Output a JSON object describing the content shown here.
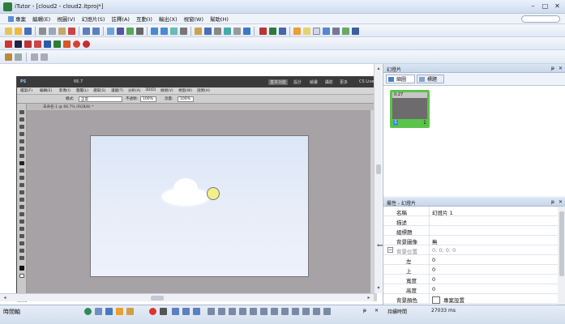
{
  "window": {
    "title": "iTutor - [cloud2 - cloud2.itproj*]",
    "controls": [
      "–",
      "□",
      "✕"
    ]
  },
  "menu": [
    "專案",
    "編輯(E)",
    "視圖(V)",
    "幻燈片(S)",
    "註釋(A)",
    "互動(I)",
    "輸出(X)",
    "視窗(W)",
    "幫助(H)"
  ],
  "photoshop": {
    "top_label": "PS",
    "zoom": "66.7",
    "workspace_buttons": [
      "基本功能",
      "設計",
      "繪畫",
      "攝影",
      "更多"
    ],
    "cs_live": "CS Live",
    "menu": [
      "檔案(F)",
      "編輯(E)",
      "影像(I)",
      "圖層(L)",
      "選取(S)",
      "濾鏡(T)",
      "分析(A)",
      "3D(D)",
      "檢視(V)",
      "視窗(W)",
      "說明(H)"
    ],
    "options": {
      "mode_label": "模式:",
      "mode_value": "正常",
      "opacity_label": "不透明:",
      "opacity_value": "100%",
      "flow_label": "流量:",
      "flow_value": "100%"
    },
    "doc_tab": "未命名-1 @ 66.7% (RGB/8) *"
  },
  "right_panel": {
    "slides_title": "幻燈片",
    "tabs": [
      "縮圖",
      "標題"
    ],
    "slide": {
      "time": "0:27",
      "index_badge": "1",
      "number": "1"
    },
    "props_title": "屬性 - 幻燈片",
    "properties": [
      {
        "key": "名稱",
        "value": "幻燈片 1"
      },
      {
        "key": "描述",
        "value": ""
      },
      {
        "key": "組標題",
        "value": ""
      },
      {
        "key": "背景圖像",
        "value": "無"
      },
      {
        "key": "背景位置",
        "value": "0; 0; 0; 0"
      },
      {
        "key": "左",
        "value": "0"
      },
      {
        "key": "上",
        "value": "0"
      },
      {
        "key": "寬度",
        "value": "0"
      },
      {
        "key": "高度",
        "value": "0"
      },
      {
        "key": "背景顏色",
        "value": "專案設置"
      },
      {
        "key": "持續時間",
        "value": "27033 ms"
      }
    ],
    "pin": "ᵽ",
    "close": "✕"
  },
  "timeline": {
    "label": "時間軸",
    "pin": "ᵽ",
    "close": "✕"
  },
  "colors": {
    "accent_green": "#5cc34a",
    "sky": "#dce7f7",
    "sun": "#f1f08a"
  }
}
